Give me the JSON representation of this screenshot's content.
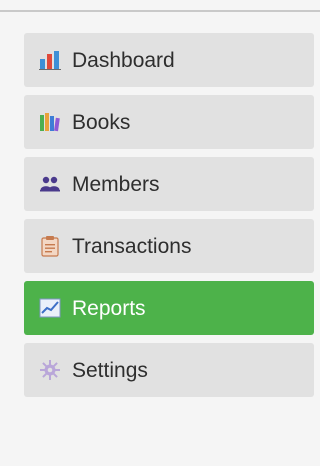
{
  "sidebar": {
    "items": [
      {
        "label": "Dashboard",
        "icon": "bar-chart-icon",
        "active": false
      },
      {
        "label": "Books",
        "icon": "books-icon",
        "active": false
      },
      {
        "label": "Members",
        "icon": "members-icon",
        "active": false
      },
      {
        "label": "Transactions",
        "icon": "clipboard-icon",
        "active": false
      },
      {
        "label": "Reports",
        "icon": "line-chart-icon",
        "active": true
      },
      {
        "label": "Settings",
        "icon": "gear-icon",
        "active": false
      }
    ],
    "active_color": "#4db24a",
    "item_color": "#e1e1e1"
  }
}
